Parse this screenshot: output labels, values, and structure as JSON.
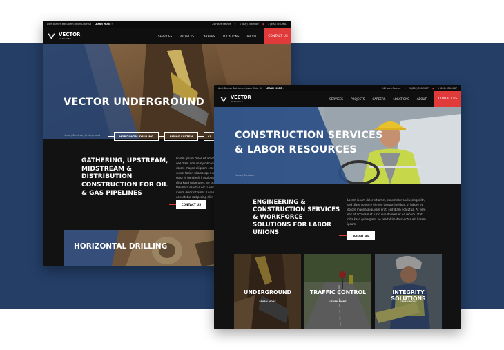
{
  "back_window": {
    "topbar": {
      "banner_text": "Alert Banner Text Lorem Ipsum Dolor Sit",
      "banner_link": "LEARN MORE →",
      "service_hours": "24 Hours Service",
      "phone": "1 (800) 356-9687",
      "phone_alt": "1 (800) 356-9687"
    },
    "logo": {
      "name": "VECTOR",
      "sub": "SERVICES"
    },
    "nav": [
      "SERVICES",
      "PROJECTS",
      "CAREERS",
      "LOCATIONS",
      "ABOUT"
    ],
    "cta": "CONTACT US",
    "hero_title": "VECTOR UNDERGROUND",
    "breadcrumb": "Home  /  Services  /  Underground",
    "chips": [
      "HORIZONTAL DRILLING",
      "PIPING SYSTEM",
      "CI"
    ],
    "section_title": "GATHERING, UPSTREAM, MIDSTREAM & DISTRIBUTION CONSTRUCTION FOR OIL & GAS PIPELINES",
    "body_text": "Lorem ipsum dolor sit amet, sed diam nonummy nibh euis dolore magna aliquam erat. exerci tation ullamcorper sus dolor in hendrerit in vulputa clita kasd gubergren, no sea takimata sanctus est. Lorem ipsum dolor sit amet. Lorem consetetur sadipscing elitr.",
    "button": "CONTACT US",
    "strip_title": "HORIZONTAL DRILLING"
  },
  "front_window": {
    "topbar": {
      "banner_text": "Alert Banner Text Lorem Ipsum Dolor Sit",
      "banner_link": "LEARN MORE →",
      "service_hours": "24 Hours Service",
      "phone": "1 (800) 356-9687",
      "phone_alt": "1 (800) 356-9687"
    },
    "logo": {
      "name": "VECTOR",
      "sub": "SERVICES"
    },
    "nav": [
      "SERVICES",
      "PROJECTS",
      "CAREERS",
      "LOCATIONS",
      "ABOUT"
    ],
    "cta": "CONTACT US",
    "hero_title_line1": "CONSTRUCTION SERVICES",
    "hero_title_line2": "& LABOR RESOURCES",
    "breadcrumb": "Home  /  Services",
    "section_title": "ENGINEERING & CONSTRUCTION SERVICES & WORKFORCE SOLUTIONS FOR LABOR UNIONS",
    "body_text": "Lorem ipsum dolor sit amet, consetetur sadipscing elitr, sed diam nonumy eirmod tempor invidunt ut labore et dolore magna aliquyam erat, sed diam voluptua. At vero eos et accusam et justo duo dolores et ea rebum. Stet clita kasd gubergren, no sea takimata sanctus est Lorem ipsum.",
    "button": "ABOUT US",
    "tiles": [
      {
        "title": "UNDERGROUND",
        "link": "LEARN MORE"
      },
      {
        "title": "TRAFFIC CONTROL",
        "link": "LEARN MORE"
      },
      {
        "title": "INTEGRITY SOLUTIONS",
        "link": "LEARN MORE"
      }
    ]
  },
  "colors": {
    "navy": "#243e66",
    "accent_red": "#e03a3a",
    "dark": "#121212",
    "overlay_blue": "#2d4f86"
  }
}
